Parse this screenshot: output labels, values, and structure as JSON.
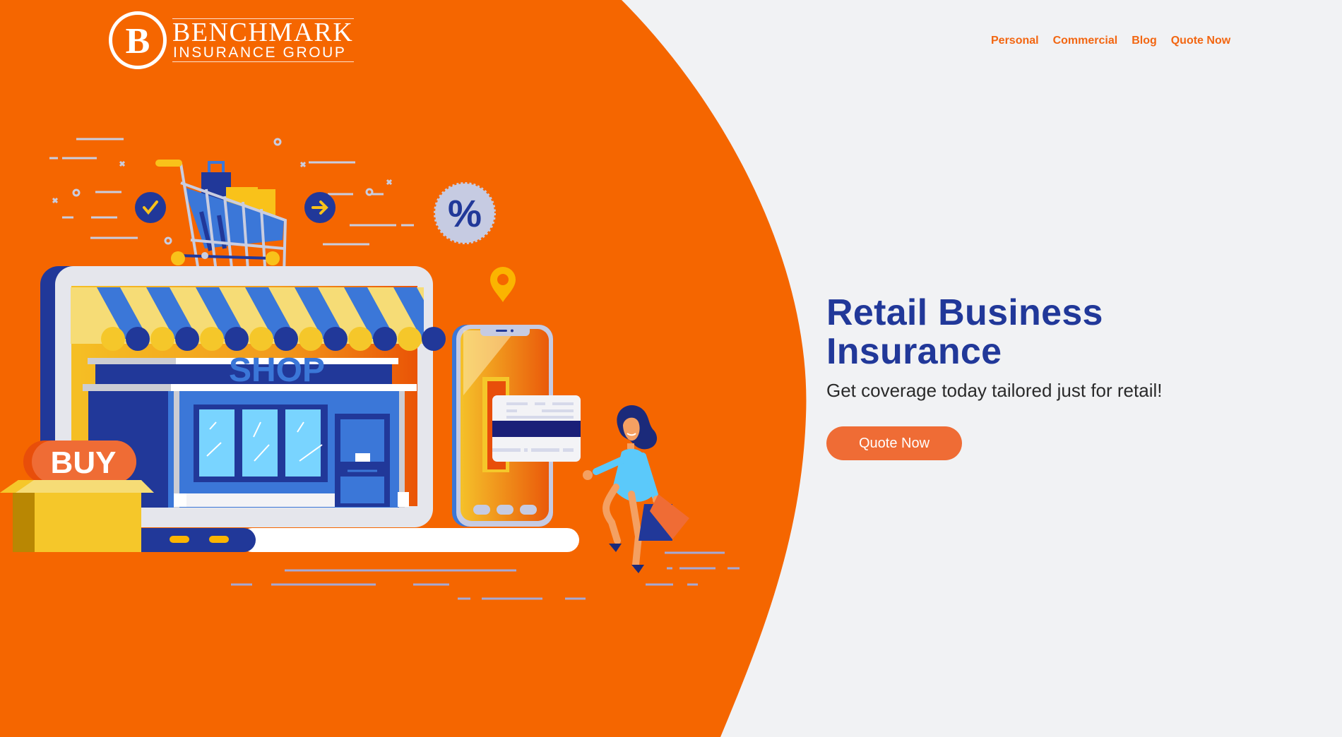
{
  "brand": {
    "monogram": "B",
    "name_line1": "BENCHMARK",
    "name_line2": "INSURANCE GROUP"
  },
  "nav": {
    "items": [
      {
        "label": "Personal"
      },
      {
        "label": "Commercial"
      },
      {
        "label": "Blog"
      },
      {
        "label": "Quote Now"
      }
    ]
  },
  "hero": {
    "title_line1": "Retail Business",
    "title_line2": "Insurance",
    "subtitle": "Get coverage today tailored just for retail!",
    "cta_label": "Quote Now"
  },
  "illustration": {
    "shop_sign": "SHOP",
    "buy_label": "BUY",
    "discount_symbol": "%"
  },
  "colors": {
    "brand_orange": "#f56600",
    "nav_orange": "#f26611",
    "cta_orange": "#ef6c35",
    "heading_blue": "#213899",
    "page_bg": "#f1f2f4"
  }
}
